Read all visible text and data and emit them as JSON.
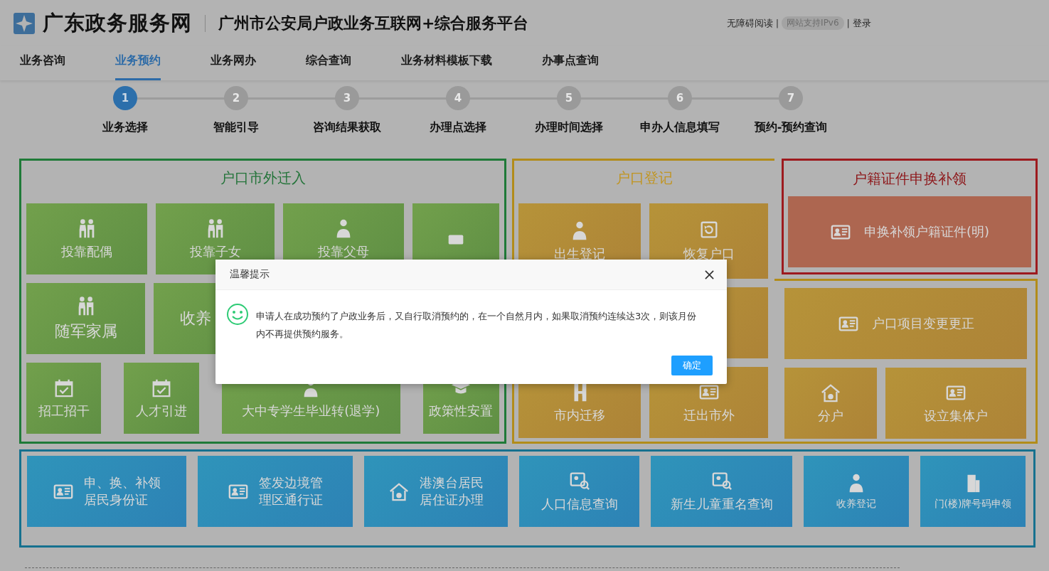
{
  "header": {
    "site_name": "广东政务服务网",
    "platform_title": "广州市公安局户政业务互联网+综合服务平台",
    "links": [
      {
        "label": "无障碍阅读",
        "kind": "link"
      },
      {
        "label": "|",
        "kind": "sep"
      },
      {
        "label": "网站支持IPv6",
        "kind": "badge"
      },
      {
        "label": "|",
        "kind": "sep"
      },
      {
        "label": "登录",
        "kind": "link"
      }
    ]
  },
  "nav": [
    {
      "label": "业务咨询",
      "selected": false
    },
    {
      "label": "业务预约",
      "selected": true
    },
    {
      "label": "业务网办",
      "selected": false
    },
    {
      "label": "综合查询",
      "selected": false
    },
    {
      "label": "业务材料模板下载",
      "selected": false
    },
    {
      "label": "办事点查询",
      "selected": false
    }
  ],
  "steps": [
    {
      "number": "1",
      "label": "业务选择",
      "selected": true
    },
    {
      "number": "2",
      "label": "智能引导",
      "selected": false
    },
    {
      "number": "3",
      "label": "咨询结果获取",
      "selected": false
    },
    {
      "number": "4",
      "label": "办理点选择",
      "selected": false
    },
    {
      "number": "5",
      "label": "办理时间选择",
      "selected": false
    },
    {
      "number": "6",
      "label": "申办人信息填写",
      "selected": false
    },
    {
      "number": "7",
      "label": "预约-预约查询",
      "selected": false
    }
  ],
  "panels": [
    {
      "title": "户口市外迁入",
      "kind": "green",
      "tile_groups": [
        [
          {
            "label": "投靠配偶"
          },
          {
            "label": "投靠子女"
          },
          {
            "label": "投靠父母"
          }
        ],
        [
          {
            "label": "随军家属"
          },
          {
            "label": "收养"
          }
        ],
        [
          {
            "label": "招工招干"
          },
          {
            "label": "人才引进"
          },
          {
            "label": "大中专学生毕业转(退学)"
          },
          {
            "label": "政策性安置"
          }
        ]
      ]
    },
    {
      "title": "户口登记",
      "kind": "yellow",
      "tile_groups": [
        [
          {
            "label": "出生登记"
          },
          {
            "label": "恢复户口"
          }
        ],
        [
          {
            "label": "市内迁移"
          },
          {
            "label": "迁出市外"
          }
        ]
      ]
    },
    {
      "title": "户籍证件申换补领",
      "kind": "red",
      "tile_groups": [
        [
          {
            "label": "申换补领户籍证件(明)"
          }
        ]
      ]
    },
    {
      "kind": "yellow",
      "tile_groups": [
        [
          {
            "label": "户口项目变更更正"
          }
        ],
        [
          {
            "label": "分户"
          },
          {
            "label": "设立集体户"
          }
        ]
      ]
    },
    {
      "kind": "blue",
      "tile_groups": [
        [
          {
            "label": "申、换、补领居民身份证"
          },
          {
            "label": "签发边境管理区通行证"
          },
          {
            "label": "港澳台居民居住证办理"
          },
          {
            "label": "人口信息查询"
          },
          {
            "label": "新生儿童重名查询"
          },
          {
            "label": "收养登记"
          },
          {
            "label": "门(楼)牌号码申领"
          }
        ]
      ]
    }
  ],
  "dialog": {
    "title": "温馨提示",
    "message": "申请人在成功预约了户政业务后，又自行取消预约的，在一个自然月内，如果取消预约连续达3次，则该月份内不再提供预约服务。",
    "button": "确定"
  }
}
